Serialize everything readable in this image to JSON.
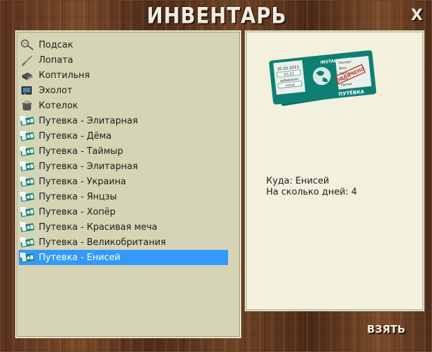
{
  "window": {
    "title": "ИНВЕНТАРЬ",
    "close_label": "X"
  },
  "inventory": {
    "items": [
      {
        "label": "Подсак",
        "icon": "landing-net-icon"
      },
      {
        "label": "Лопата",
        "icon": "shovel-icon"
      },
      {
        "label": "Коптильня",
        "icon": "smokehouse-icon"
      },
      {
        "label": "Эхолот",
        "icon": "echo-sounder-icon"
      },
      {
        "label": "Котелок",
        "icon": "pot-icon"
      },
      {
        "label": "Путевка - Элитарная",
        "icon": "voucher-icon"
      },
      {
        "label": "Путевка - Дёма",
        "icon": "voucher-icon"
      },
      {
        "label": "Путевка - Таймыр",
        "icon": "voucher-icon"
      },
      {
        "label": "Путевка - Элитарная",
        "icon": "voucher-icon"
      },
      {
        "label": "Путевка - Украина",
        "icon": "voucher-icon"
      },
      {
        "label": "Путевка - Янцзы",
        "icon": "voucher-icon"
      },
      {
        "label": "Путевка - Хопёр",
        "icon": "voucher-icon"
      },
      {
        "label": "Путевка - Красивая меча",
        "icon": "voucher-icon"
      },
      {
        "label": "Путевка - Великобритания",
        "icon": "voucher-icon"
      },
      {
        "label": "Путевка - Енисей",
        "icon": "voucher-icon",
        "selected": true
      }
    ]
  },
  "detail": {
    "ticket": {
      "brand": "INSTALLSOFT",
      "date": "01.01.2011",
      "time": "03:23",
      "added_label": "добавлено:",
      "added_value": "install",
      "stamp": "ОПЛАЧЕНО",
      "fields": [
        "Паспорт",
        "Виза",
        "Паспорт",
        "Виза",
        "Удочки"
      ],
      "footer": "ПУТЁВКА"
    },
    "destination": "Куда: Енисей",
    "days": "На сколько дней: 4"
  },
  "take_button": {
    "label": "ВЗЯТЬ"
  },
  "colors": {
    "selection": "#3399ff",
    "list_bg": "#d5d4b4",
    "detail_bg": "#f2f1dd",
    "ticket_teal": "#0e7f73"
  }
}
